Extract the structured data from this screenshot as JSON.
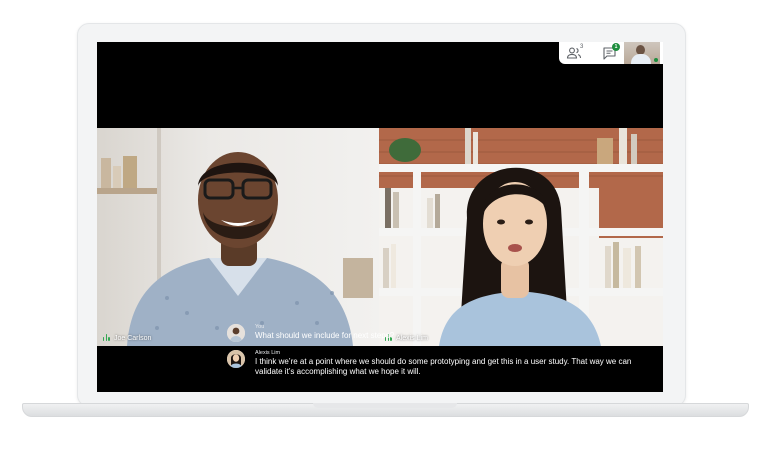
{
  "toolbar": {
    "people_count": "3",
    "chat_badge": "1"
  },
  "tiles": [
    {
      "name": "Joe Carlson"
    },
    {
      "name": "Alexis Lim"
    }
  ],
  "captions": [
    {
      "speaker": "You",
      "text": "What should we include for next steps?"
    },
    {
      "speaker": "Alexis Lim",
      "text": "I think we’re at a point where we should do some prototyping and get this in a user study. That way we can validate it’s accomplishing what we hope it will."
    }
  ],
  "colors": {
    "active_green": "#34a853",
    "screen": "#000000"
  },
  "icons": [
    "people-icon",
    "chat-icon",
    "mic-active-icon"
  ]
}
